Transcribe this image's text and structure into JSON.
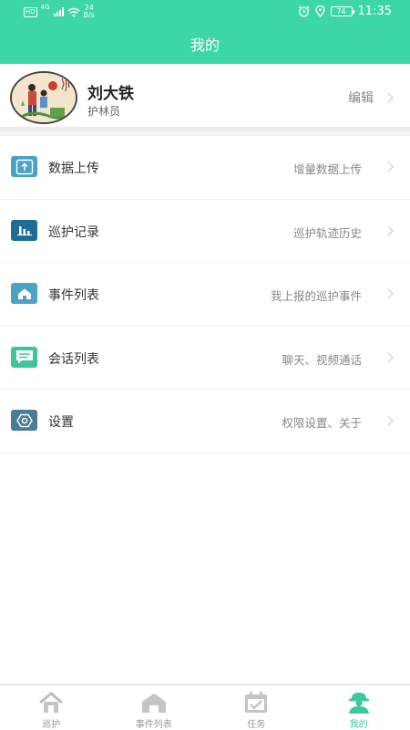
{
  "status_bar": {
    "network": "4G",
    "speed_value": "24",
    "speed_unit": "B/s",
    "battery": "74",
    "time": "11:35"
  },
  "header": {
    "title": "我的"
  },
  "profile": {
    "name": "刘大铁",
    "role": "护林员",
    "edit_label": "编辑"
  },
  "menu": [
    {
      "label": "数据上传",
      "hint": "增量数据上传",
      "icon": "upload-icon"
    },
    {
      "label": "巡护记录",
      "hint": "巡护轨迹历史",
      "icon": "bar-chart-icon"
    },
    {
      "label": "事件列表",
      "hint": "我上报的巡护事件",
      "icon": "house-icon"
    },
    {
      "label": "会话列表",
      "hint": "聊天、视频通话",
      "icon": "chat-icon"
    },
    {
      "label": "设置",
      "hint": "权限设置、关于",
      "icon": "settings-icon"
    }
  ],
  "tabs": [
    {
      "label": "巡护",
      "icon": "home-icon"
    },
    {
      "label": "事件列表",
      "icon": "event-icon"
    },
    {
      "label": "任务",
      "icon": "calendar-check-icon"
    },
    {
      "label": "我的",
      "icon": "user-icon",
      "active": true
    }
  ],
  "colors": {
    "accent": "#3dd6a5",
    "tab_active": "#3dc89a",
    "icon_teal": "#4ba3c3",
    "icon_navy": "#1e6a98",
    "icon_green": "#3fc59a",
    "icon_slate": "#4a7b97"
  }
}
